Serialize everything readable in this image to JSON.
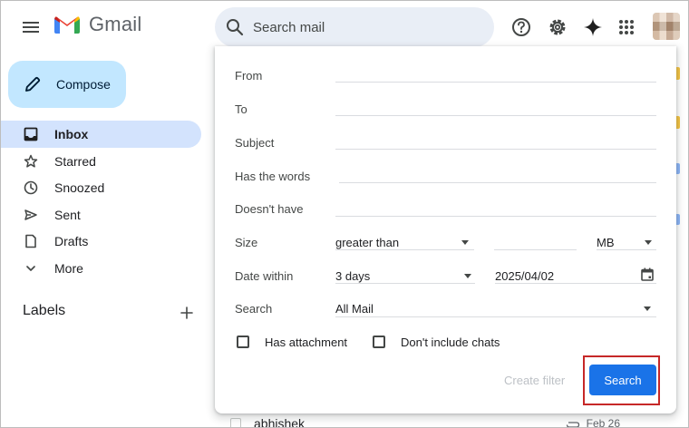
{
  "header": {
    "app_name": "Gmail",
    "search_placeholder": "Search mail"
  },
  "sidebar": {
    "compose_label": "Compose",
    "items": [
      {
        "label": "Inbox",
        "icon": "inbox-icon",
        "active": true
      },
      {
        "label": "Starred",
        "icon": "star-icon"
      },
      {
        "label": "Snoozed",
        "icon": "clock-icon"
      },
      {
        "label": "Sent",
        "icon": "send-icon"
      },
      {
        "label": "Drafts",
        "icon": "draft-icon"
      },
      {
        "label": "More",
        "icon": "chevron-down-icon"
      }
    ],
    "labels_heading": "Labels"
  },
  "search_panel": {
    "from_label": "From",
    "to_label": "To",
    "subject_label": "Subject",
    "has_words_label": "Has the words",
    "doesnt_have_label": "Doesn't have",
    "size_label": "Size",
    "size_operator": "greater than",
    "size_value": "",
    "size_unit": "MB",
    "date_within_label": "Date within",
    "date_within_value": "3 days",
    "date_value": "2025/04/02",
    "search_label": "Search",
    "search_scope": "All Mail",
    "has_attachment_label": "Has attachment",
    "has_attachment_checked": false,
    "dont_include_chats_label": "Don't include chats",
    "dont_include_chats_checked": false,
    "create_filter_label": "Create filter",
    "search_button_label": "Search"
  },
  "background_mail": {
    "sender": "abhishek",
    "date": "Feb 26"
  },
  "colors": {
    "compose_bg": "#c2e7ff",
    "active_nav_bg": "#d3e3fd",
    "search_bar_bg": "#e9eef6",
    "primary_button": "#1a73e8",
    "highlight": "#c62828"
  }
}
